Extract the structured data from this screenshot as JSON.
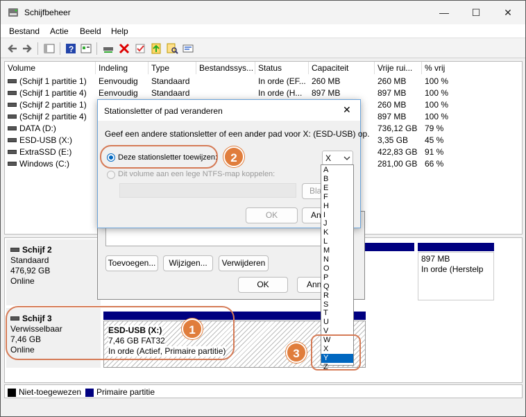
{
  "window": {
    "title": "Schijfbeheer",
    "controls": {
      "minimize": "—",
      "maximize": "☐",
      "close": "✕"
    }
  },
  "menu": [
    "Bestand",
    "Actie",
    "Beeld",
    "Help"
  ],
  "toolbar_icons": [
    "back-icon",
    "forward-icon",
    "console-icon",
    "help-icon",
    "properties-icon",
    "connect-icon",
    "delete-icon",
    "check-icon",
    "up-icon",
    "search-icon",
    "format-icon"
  ],
  "volumes": {
    "headers": [
      "Volume",
      "Indeling",
      "Type",
      "Bestandssys...",
      "Status",
      "Capaciteit",
      "Vrije rui...",
      "% vrij"
    ],
    "rows": [
      [
        "(Schijf 1 partitie 1)",
        "Eenvoudig",
        "Standaard",
        "",
        "In orde (EF...",
        "260 MB",
        "260 MB",
        "100 %"
      ],
      [
        "(Schijf 1 partitie 4)",
        "Eenvoudig",
        "Standaard",
        "",
        "In orde (H...",
        "897 MB",
        "897 MB",
        "100 %"
      ],
      [
        "(Schijf 2 partitie 1)",
        "",
        "",
        "",
        "",
        "",
        "260 MB",
        "100 %"
      ],
      [
        "(Schijf 2 partitie 4)",
        "",
        "",
        "",
        "",
        "",
        "897 MB",
        "100 %"
      ],
      [
        "DATA (D:)",
        "",
        "",
        "",
        "",
        "",
        "736,12 GB",
        "79 %"
      ],
      [
        "ESD-USB (X:)",
        "",
        "",
        "",
        "",
        "",
        "3,35 GB",
        "45 %"
      ],
      [
        "ExtraSSD (E:)",
        "",
        "",
        "",
        "",
        "",
        "422,83 GB",
        "91 %"
      ],
      [
        "Windows  (C:)",
        "",
        "",
        "",
        "",
        "",
        "281,00 GB",
        "66 %"
      ]
    ]
  },
  "disks": {
    "disk2": {
      "name": "Schijf 2",
      "type": "Standaard",
      "size": "476,92 GB",
      "state": "Online",
      "part_size": "897 MB",
      "part_status": "In orde (Herstelp"
    },
    "disk3": {
      "name": "Schijf 3",
      "type": "Verwisselbaar",
      "size": "7,46 GB",
      "state": "Online",
      "part_name": "ESD-USB  (X:)",
      "part_size": "7,46 GB FAT32",
      "part_status": "In orde (Actief, Primaire partitie)"
    }
  },
  "legend": {
    "unallocated": "Niet-toegewezen",
    "primary": "Primaire partitie"
  },
  "back_dialog": {
    "buttons": [
      "Toevoegen...",
      "Wijzigen...",
      "Verwijderen"
    ],
    "ok": "OK",
    "cancel": "Annu"
  },
  "dialog": {
    "title": "Stationsletter of pad veranderen",
    "description": "Geef een andere stationsletter of een ander pad voor X: (ESD-USB) op.",
    "option_letter": "Deze stationsletter toewijzen:",
    "option_folder": "Dit volume aan een lege NTFS-map koppelen:",
    "browse": "Blade",
    "ok": "OK",
    "cancel": "Ann",
    "selected_letter": "X",
    "letters": [
      "A",
      "B",
      "E",
      "F",
      "H",
      "I",
      "J",
      "K",
      "L",
      "M",
      "N",
      "O",
      "P",
      "Q",
      "R",
      "S",
      "T",
      "U",
      "V",
      "W",
      "X",
      "Y",
      "Z"
    ],
    "highlighted": "Y"
  },
  "callouts": [
    "1",
    "2",
    "3"
  ],
  "colors": {
    "primary_partition": "#000080",
    "accent": "#0067c0",
    "callout": "#e07d3c"
  }
}
